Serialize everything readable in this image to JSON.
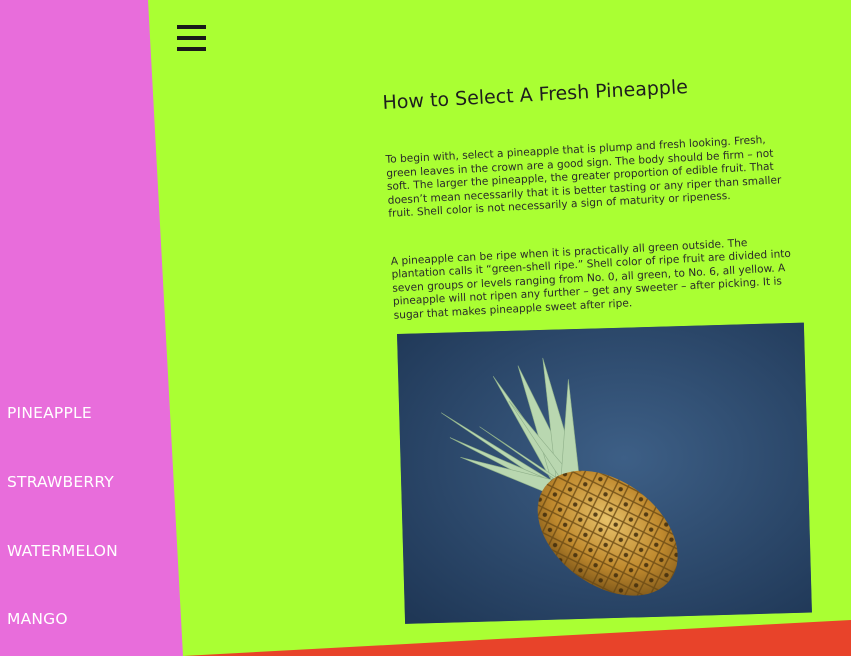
{
  "nav": {
    "items": [
      {
        "label": "PINEAPPLE"
      },
      {
        "label": "STRAWBERRY"
      },
      {
        "label": "WATERMELON"
      },
      {
        "label": "MANGO"
      }
    ]
  },
  "header": {
    "menu_icon": "hamburger-menu-icon"
  },
  "article": {
    "title": "How to Select A Fresh Pineapple",
    "paragraphs": [
      "To begin with, select a pineapple that is plump and fresh looking. Fresh, green leaves in the crown are a good sign. The body should be firm – not soft. The larger the pineapple, the greater proportion of edible fruit. That doesn’t mean necessarily that it is better tasting or any riper than smaller fruit. Shell color is not necessarily a sign of maturity or ripeness.",
      "A pineapple can be ripe when it is practically all green outside. The plantation calls it “green-shell ripe.” Shell color of ripe fruit are divided into seven groups or levels ranging from No. 0, all green, to No. 6, all yellow. A pineapple will not ripen any further – get any sweeter – after picking. It is sugar that makes pineapple sweet after ripe."
    ],
    "image": "pineapple-photo"
  },
  "colors": {
    "background": "#aaff33",
    "sidebar": "#e86ddb",
    "footer_band": "#e8432a",
    "photo_bg": "#2c4a6e"
  }
}
